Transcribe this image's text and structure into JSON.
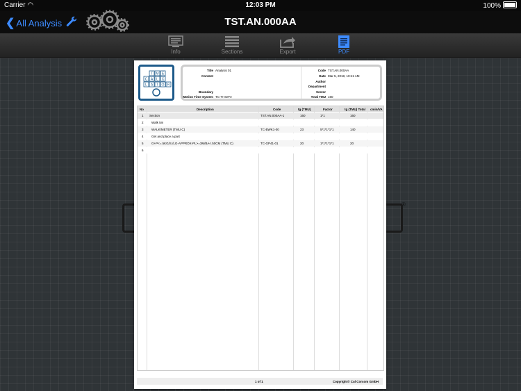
{
  "status_bar": {
    "carrier": "Carrier",
    "time": "12:03 PM",
    "battery": "100%"
  },
  "nav": {
    "back_label": "All Analysis",
    "title": "TST.AN.000AA"
  },
  "tabs": [
    {
      "label": "Info",
      "icon": "info-icon",
      "active": false
    },
    {
      "label": "Sections",
      "icon": "sections-icon",
      "active": false
    },
    {
      "label": "Export",
      "icon": "export-icon",
      "active": false
    },
    {
      "label": "PDF",
      "icon": "pdf-icon",
      "active": true
    }
  ],
  "colors": {
    "accent": "#3d8bff",
    "logo_border": "#1d5a8a"
  },
  "document": {
    "logo_letters": [
      "T",
      "M",
      "E",
      "C",
      "A",
      "L",
      "C",
      "L",
      "A",
      "T",
      "O",
      "R"
    ],
    "header_fields": {
      "title_label": "Title",
      "title_value": "Analysis 01",
      "content_label": "Content",
      "content_value": "",
      "boundary_label": "Boundary",
      "boundary_value": "",
      "mts_label": "Motion Time System",
      "mts_value": "TC-TI-SeFe",
      "code_label": "Code",
      "code_value": "TST.AN.000AA",
      "date_label": "Date",
      "date_value": "Mar 5, 2018, 10:41 AM",
      "author_label": "Author",
      "author_value": "",
      "department_label": "Department",
      "department_value": "",
      "sector_label": "Sector",
      "sector_value": "",
      "total_label": "Total TMU",
      "total_value": "160"
    },
    "table": {
      "columns": [
        "No",
        "Description",
        "Code",
        "tg (TMU)",
        "Factor",
        "tg (TMU) Total",
        "cmin/VA"
      ],
      "rows": [
        {
          "no": "1",
          "description": "Section",
          "code": "TST.AN.000AA-1",
          "tg": "160",
          "factor": "1*1",
          "total": "160",
          "cmin": ""
        },
        {
          "no": "2",
          "description": "Walk 5m",
          "code": "",
          "tg": "",
          "factor": "",
          "total": "",
          "cmin": ""
        },
        {
          "no": "3",
          "description": "WALK/METER (TMU C)",
          "code": "TC-BWK1-00",
          "tg": "23",
          "factor": "5*1*1*1*1",
          "total": "140",
          "cmin": ""
        },
        {
          "no": "4",
          "description": "Get and place a part",
          "code": "",
          "tg": "",
          "factor": "",
          "total": "",
          "cmin": ""
        },
        {
          "no": "5",
          "description": "G+P<=.5KG/S./LG-APPROX-PL>=3M/BA<.50CM (TMU C)",
          "code": "TC-GP41-01",
          "tg": "20",
          "factor": "1*1*1*1*1",
          "total": "20",
          "cmin": ""
        },
        {
          "no": "6",
          "description": "",
          "code": "",
          "tg": "",
          "factor": "",
          "total": "",
          "cmin": ""
        }
      ]
    },
    "footer": {
      "page": "1 of 1",
      "copyright": "Copyright© Cul Corcom GmbH"
    }
  }
}
